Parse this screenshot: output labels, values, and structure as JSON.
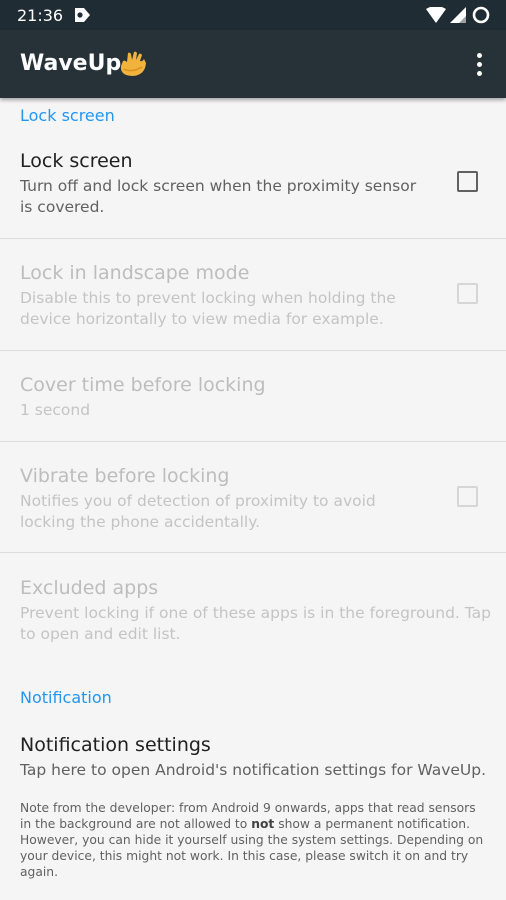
{
  "status_bar": {
    "time": "21:36",
    "icons": [
      "notification-icon",
      "wifi-icon",
      "signal-icon",
      "battery-icon"
    ]
  },
  "app_bar": {
    "title": "WaveUp",
    "logo_icon": "waving-hand-icon",
    "overflow_icon": "more-vert-icon",
    "background": "#263238"
  },
  "colors": {
    "accent": "#2196f3",
    "status_bar": "#1f2c33",
    "text_primary": "#212121",
    "text_secondary": "#616161",
    "text_disabled": "#bdbdbd"
  },
  "sections": {
    "lock_screen": {
      "header": "Lock screen",
      "lock_screen": {
        "title": "Lock screen",
        "summary": "Turn off and lock screen when the proximity sensor is covered.",
        "checked": false,
        "enabled": true
      },
      "lock_landscape": {
        "title": "Lock in landscape mode",
        "summary": "Disable this to prevent locking when holding the device horizontally to view media for example.",
        "checked": false,
        "enabled": false
      },
      "cover_time": {
        "title": "Cover time before locking",
        "summary": "1 second",
        "enabled": false
      },
      "vibrate": {
        "title": "Vibrate before locking",
        "summary": "Notifies you of detection of proximity to avoid locking the phone accidentally.",
        "checked": false,
        "enabled": false
      },
      "excluded_apps": {
        "title": "Excluded apps",
        "summary": "Prevent locking if one of these apps is in the foreground. Tap to open and edit list.",
        "enabled": false
      }
    },
    "notification": {
      "header": "Notification",
      "settings": {
        "title": "Notification settings",
        "summary": "Tap here to open Android's notification settings for WaveUp."
      },
      "note_before_bold": "Note from the developer: from Android 9 onwards, apps that read sensors in the background are not allowed to ",
      "note_bold": "not",
      "note_after_bold": " show a permanent notification. However, you can hide it yourself using the system settings. Depending on your device, this might not work. In this case, please switch it on and try again."
    }
  }
}
